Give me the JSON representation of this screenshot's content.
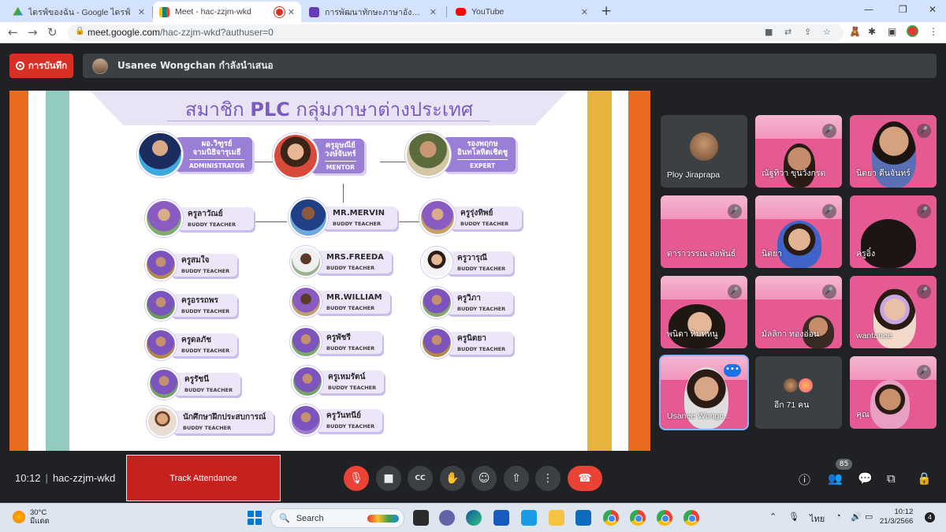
{
  "browser": {
    "tabs": [
      {
        "title": "ไดรฟ์ของฉัน - Google ไดรฟ์",
        "icon": "google-drive-icon",
        "color": "#34a853"
      },
      {
        "title": "Meet - hac-zzjm-wkd",
        "icon": "google-meet-icon",
        "color": "#00897b",
        "recording": true
      },
      {
        "title": "การพัฒนาทักษะภาษาอังกฤษ English",
        "icon": "google-forms-icon",
        "color": "#673ab7"
      },
      {
        "title": "YouTube",
        "icon": "youtube-icon",
        "color": "#ff0000"
      }
    ],
    "url_host": "meet.google.com",
    "url_path": "/hac-zzjm-wkd?authuser=0"
  },
  "meet": {
    "record_label": "การบันทึก",
    "presenter_text": "Usanee Wongchan กำลังนำเสนอ",
    "meeting_time": "10:12",
    "meeting_code": "hac-zzjm-wkd",
    "track_attendance_label": "Track Attendance",
    "people_count": "85",
    "end_call_color": "#ea4335"
  },
  "slide": {
    "title_pre": "สมาชิก ",
    "title_bold": "PLC",
    "title_post": " กลุ่มภาษาต่างประเทศ",
    "leaders": [
      {
        "name_l1": "ผอ.วิฑูรย์",
        "name_l2": "จามนิธิจารุเมธี",
        "role": "ADMINISTRATOR"
      },
      {
        "name_l1": "ครูอุษณีย์",
        "name_l2": "วงษ์จันทร์",
        "role": "MENTOR"
      },
      {
        "name_l1": "รองพฤกษ",
        "name_l2": "อินทโลหิตเชิดชู",
        "role": "EXPERT"
      }
    ],
    "buddy_role": "BUDDY TEACHER",
    "col1": [
      "ครูลาวัณย์",
      "ครูสมใจ",
      "ครูอรรถพร",
      "ครูดลภัช",
      "ครูรัชนี",
      "นักศึกษาฝึกประสบการณ์"
    ],
    "col2": [
      "MR.MERVIN",
      "MRS.FREEDA",
      "MR.WILLIAM",
      "ครูพัชรี",
      "ครูเหมรัตน์",
      "ครูวันทนีย์"
    ],
    "col3": [
      "ครูรุ่งทิพย์",
      "ครูวารุณี",
      "ครูวิภา",
      "ครูนิตยา"
    ]
  },
  "participants": [
    {
      "name": "Ploy Jiraprapa"
    },
    {
      "name": "ณัฐทิวา ขุนวังกรด"
    },
    {
      "name": "นิตยา ดีนจันทร์"
    },
    {
      "name": "ดาราวรรณ ลอพันธ์"
    },
    {
      "name": "นิตยา"
    },
    {
      "name": "ครูอิ๋ง"
    },
    {
      "name": "พนิดา ทิมทหนู"
    },
    {
      "name": "มัลลิกา ทองอ่อน"
    },
    {
      "name": "wantanee"
    },
    {
      "name": "Usanee Wongc..."
    },
    {
      "name": "อีก 71 คน"
    },
    {
      "name": "คุณ"
    }
  ],
  "taskbar": {
    "temperature": "30°C",
    "weather": "มีแดด",
    "search_label": "Search",
    "language": "ไทย",
    "clock_time": "10:12",
    "clock_date": "21/3/2566",
    "notifications": "4"
  }
}
